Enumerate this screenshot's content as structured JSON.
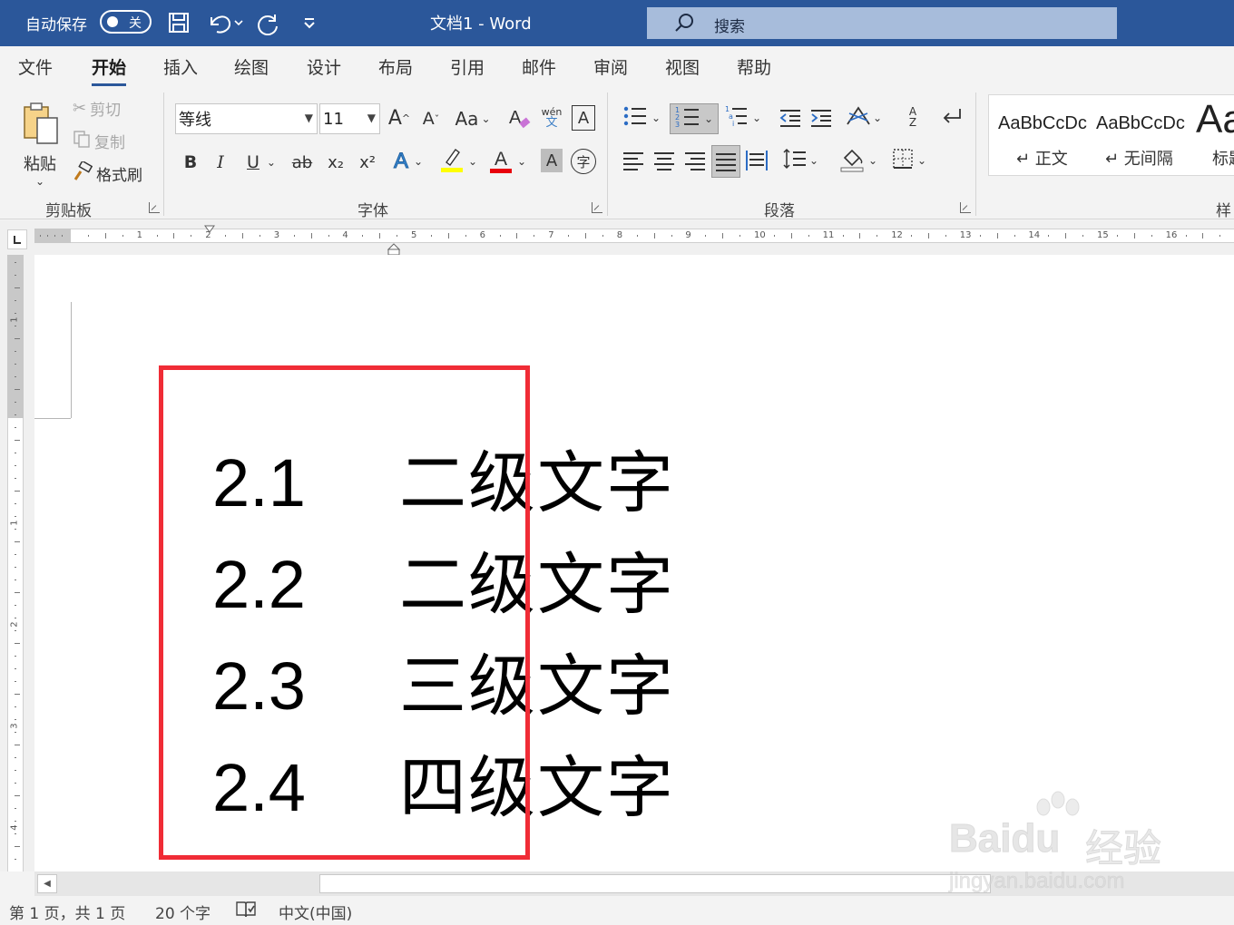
{
  "titlebar": {
    "autosave_label": "自动保存",
    "autosave_state": "关",
    "doc_title": "文档1  -  Word",
    "search_placeholder": "搜索"
  },
  "tabs": [
    "文件",
    "开始",
    "插入",
    "绘图",
    "设计",
    "布局",
    "引用",
    "邮件",
    "审阅",
    "视图",
    "帮助"
  ],
  "active_tab": "开始",
  "clipboard": {
    "paste": "粘贴",
    "cut": "剪切",
    "copy": "复制",
    "format_painter": "格式刷",
    "group": "剪贴板"
  },
  "font": {
    "family": "等线",
    "size": "11",
    "case_label": "Aa",
    "phonetic_top": "wén",
    "phonetic_bottom": "文",
    "border_char": "A",
    "bold": "B",
    "italic": "I",
    "underline": "U",
    "strike": "ab",
    "subscript": "x₂",
    "superscript": "x²",
    "effects": "A",
    "color_letter": "A",
    "shade_letter": "A",
    "enclose_char": "字",
    "group": "字体",
    "highlight_color": "#ffff00",
    "font_color": "#e8000b"
  },
  "paragraph": {
    "group": "段落",
    "sort_top": "A",
    "sort_bottom": "Z"
  },
  "styles": {
    "items": [
      {
        "sample": "AaBbCcDc",
        "name": "↵ 正文"
      },
      {
        "sample": "AaBbCcDc",
        "name": "↵ 无间隔"
      },
      {
        "sample": "Aa",
        "name": "标题"
      }
    ],
    "group": "样"
  },
  "ruler": {
    "numbers": [
      "1",
      "2",
      "3",
      "4",
      "5",
      "6",
      "7",
      "8",
      "9",
      "10",
      "11",
      "12",
      "13",
      "14",
      "15",
      "16"
    ],
    "vnumbers": [
      "1",
      "1",
      "2",
      "3",
      "4"
    ]
  },
  "document": {
    "lines": [
      {
        "num": "2.1",
        "text": "二级文字"
      },
      {
        "num": "2.2",
        "text": "二级文字"
      },
      {
        "num": "2.3",
        "text": "三级文字"
      },
      {
        "num": "2.4",
        "text": "四级文字"
      }
    ]
  },
  "statusbar": {
    "page": "第 1 页，共 1 页",
    "words": "20 个字",
    "language": "中文(中国)"
  },
  "watermark": {
    "brand": "Bai",
    "brand2": "du",
    "cn": "经验",
    "url": "jingyan.baidu.com"
  },
  "colors": {
    "titlebar": "#2b579a",
    "highlight_box": "#f02c36"
  }
}
